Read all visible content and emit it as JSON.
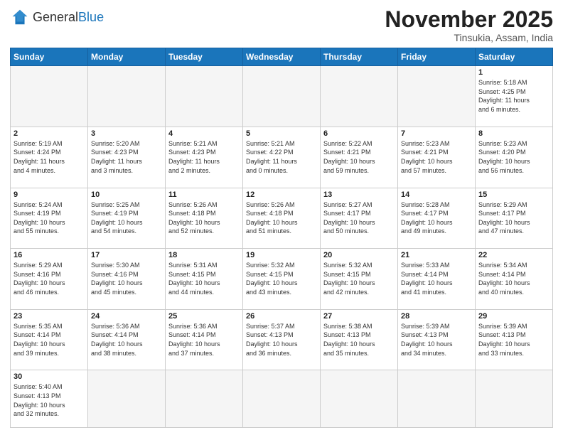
{
  "header": {
    "logo_general": "General",
    "logo_blue": "Blue",
    "month_title": "November 2025",
    "location": "Tinsukia, Assam, India"
  },
  "weekdays": [
    "Sunday",
    "Monday",
    "Tuesday",
    "Wednesday",
    "Thursday",
    "Friday",
    "Saturday"
  ],
  "weeks": [
    [
      {
        "day": "",
        "info": ""
      },
      {
        "day": "",
        "info": ""
      },
      {
        "day": "",
        "info": ""
      },
      {
        "day": "",
        "info": ""
      },
      {
        "day": "",
        "info": ""
      },
      {
        "day": "",
        "info": ""
      },
      {
        "day": "1",
        "info": "Sunrise: 5:18 AM\nSunset: 4:25 PM\nDaylight: 11 hours\nand 6 minutes."
      }
    ],
    [
      {
        "day": "2",
        "info": "Sunrise: 5:19 AM\nSunset: 4:24 PM\nDaylight: 11 hours\nand 4 minutes."
      },
      {
        "day": "3",
        "info": "Sunrise: 5:20 AM\nSunset: 4:23 PM\nDaylight: 11 hours\nand 3 minutes."
      },
      {
        "day": "4",
        "info": "Sunrise: 5:21 AM\nSunset: 4:23 PM\nDaylight: 11 hours\nand 2 minutes."
      },
      {
        "day": "5",
        "info": "Sunrise: 5:21 AM\nSunset: 4:22 PM\nDaylight: 11 hours\nand 0 minutes."
      },
      {
        "day": "6",
        "info": "Sunrise: 5:22 AM\nSunset: 4:21 PM\nDaylight: 10 hours\nand 59 minutes."
      },
      {
        "day": "7",
        "info": "Sunrise: 5:23 AM\nSunset: 4:21 PM\nDaylight: 10 hours\nand 57 minutes."
      },
      {
        "day": "8",
        "info": "Sunrise: 5:23 AM\nSunset: 4:20 PM\nDaylight: 10 hours\nand 56 minutes."
      }
    ],
    [
      {
        "day": "9",
        "info": "Sunrise: 5:24 AM\nSunset: 4:19 PM\nDaylight: 10 hours\nand 55 minutes."
      },
      {
        "day": "10",
        "info": "Sunrise: 5:25 AM\nSunset: 4:19 PM\nDaylight: 10 hours\nand 54 minutes."
      },
      {
        "day": "11",
        "info": "Sunrise: 5:26 AM\nSunset: 4:18 PM\nDaylight: 10 hours\nand 52 minutes."
      },
      {
        "day": "12",
        "info": "Sunrise: 5:26 AM\nSunset: 4:18 PM\nDaylight: 10 hours\nand 51 minutes."
      },
      {
        "day": "13",
        "info": "Sunrise: 5:27 AM\nSunset: 4:17 PM\nDaylight: 10 hours\nand 50 minutes."
      },
      {
        "day": "14",
        "info": "Sunrise: 5:28 AM\nSunset: 4:17 PM\nDaylight: 10 hours\nand 49 minutes."
      },
      {
        "day": "15",
        "info": "Sunrise: 5:29 AM\nSunset: 4:17 PM\nDaylight: 10 hours\nand 47 minutes."
      }
    ],
    [
      {
        "day": "16",
        "info": "Sunrise: 5:29 AM\nSunset: 4:16 PM\nDaylight: 10 hours\nand 46 minutes."
      },
      {
        "day": "17",
        "info": "Sunrise: 5:30 AM\nSunset: 4:16 PM\nDaylight: 10 hours\nand 45 minutes."
      },
      {
        "day": "18",
        "info": "Sunrise: 5:31 AM\nSunset: 4:15 PM\nDaylight: 10 hours\nand 44 minutes."
      },
      {
        "day": "19",
        "info": "Sunrise: 5:32 AM\nSunset: 4:15 PM\nDaylight: 10 hours\nand 43 minutes."
      },
      {
        "day": "20",
        "info": "Sunrise: 5:32 AM\nSunset: 4:15 PM\nDaylight: 10 hours\nand 42 minutes."
      },
      {
        "day": "21",
        "info": "Sunrise: 5:33 AM\nSunset: 4:14 PM\nDaylight: 10 hours\nand 41 minutes."
      },
      {
        "day": "22",
        "info": "Sunrise: 5:34 AM\nSunset: 4:14 PM\nDaylight: 10 hours\nand 40 minutes."
      }
    ],
    [
      {
        "day": "23",
        "info": "Sunrise: 5:35 AM\nSunset: 4:14 PM\nDaylight: 10 hours\nand 39 minutes."
      },
      {
        "day": "24",
        "info": "Sunrise: 5:36 AM\nSunset: 4:14 PM\nDaylight: 10 hours\nand 38 minutes."
      },
      {
        "day": "25",
        "info": "Sunrise: 5:36 AM\nSunset: 4:14 PM\nDaylight: 10 hours\nand 37 minutes."
      },
      {
        "day": "26",
        "info": "Sunrise: 5:37 AM\nSunset: 4:13 PM\nDaylight: 10 hours\nand 36 minutes."
      },
      {
        "day": "27",
        "info": "Sunrise: 5:38 AM\nSunset: 4:13 PM\nDaylight: 10 hours\nand 35 minutes."
      },
      {
        "day": "28",
        "info": "Sunrise: 5:39 AM\nSunset: 4:13 PM\nDaylight: 10 hours\nand 34 minutes."
      },
      {
        "day": "29",
        "info": "Sunrise: 5:39 AM\nSunset: 4:13 PM\nDaylight: 10 hours\nand 33 minutes."
      }
    ],
    [
      {
        "day": "30",
        "info": "Sunrise: 5:40 AM\nSunset: 4:13 PM\nDaylight: 10 hours\nand 32 minutes."
      },
      {
        "day": "",
        "info": ""
      },
      {
        "day": "",
        "info": ""
      },
      {
        "day": "",
        "info": ""
      },
      {
        "day": "",
        "info": ""
      },
      {
        "day": "",
        "info": ""
      },
      {
        "day": "",
        "info": ""
      }
    ]
  ]
}
